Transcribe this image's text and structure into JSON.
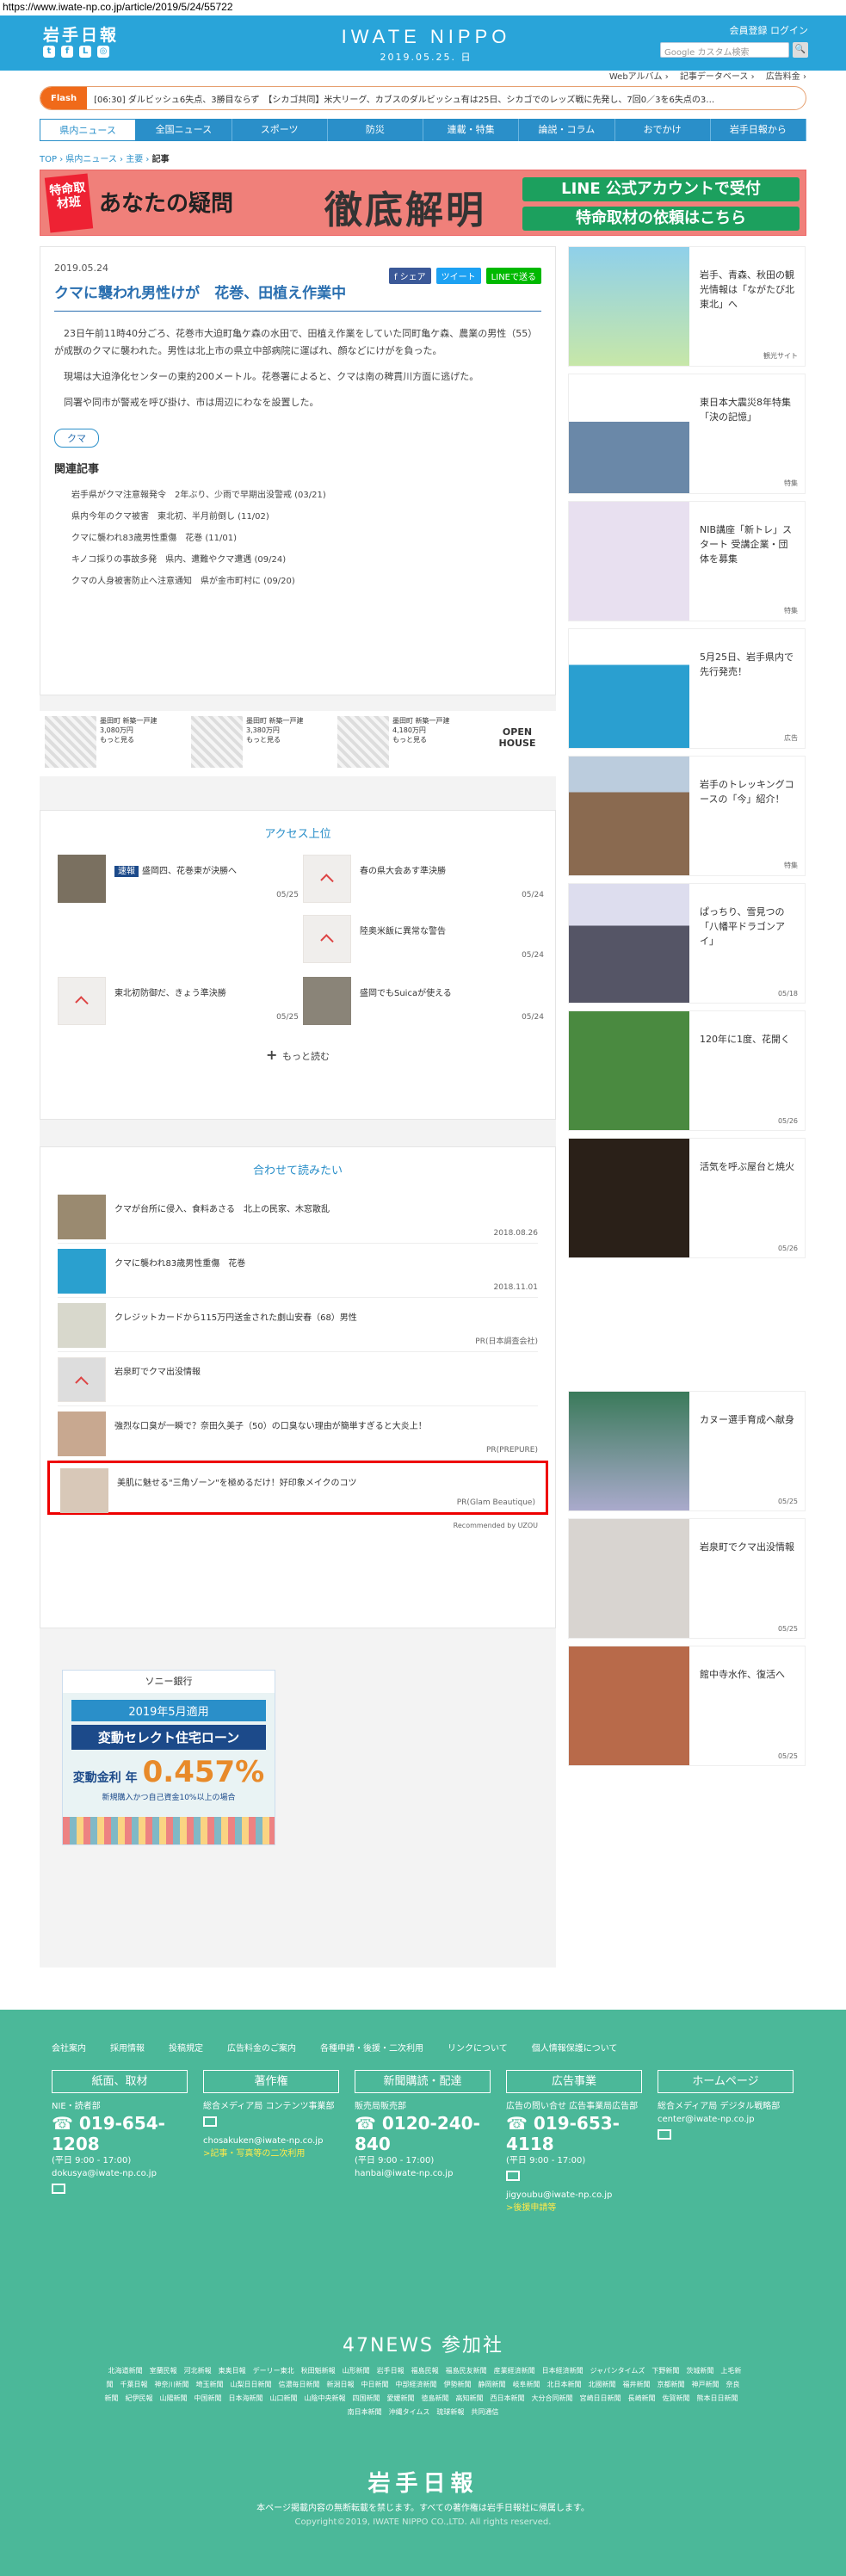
{
  "url": "https://www.iwate-np.co.jp/article/2019/5/24/55722",
  "header": {
    "logo": "岩手日報",
    "brand": "IWATE NIPPO",
    "date": "2019.05.25. 日",
    "links": "会員登録  ログイン",
    "search_placeholder": "Google カスタム検索",
    "search_btn": "🔍"
  },
  "subnav": [
    "Webアルバム ›",
    "記事データベース ›",
    "広告料金 ›"
  ],
  "flash": {
    "tag": "Flash",
    "text": "[06:30] ダルビッシュ6失点、3勝目ならず　【シカゴ共同】米大リーグ、カブスのダルビッシュ有は25日、シカゴでのレッズ戦に先発し、7回0／3を6失点の3…"
  },
  "gnav": [
    "県内ニュース",
    "全国ニュース",
    "スポーツ",
    "防災",
    "連載・特集",
    "論説・コラム",
    "おでかけ",
    "岩手日報から"
  ],
  "breadcrumb": {
    "top": "TOP",
    "sep": " › ",
    "c1": "県内ニュース",
    "c2": "主要",
    "current": "記事"
  },
  "banner": {
    "b1": "特命取材班",
    "b2": "あなたの疑問",
    "b3": "徹底解明",
    "b4": "LINE 公式アカウントで受付",
    "b5": "特命取材の依頼はこちら"
  },
  "article": {
    "date": "2019.05.24",
    "share": [
      "f シェア",
      "ツイート",
      "LINEで送る"
    ],
    "title": "クマに襲われ男性けが　花巻、田植え作業中",
    "body": [
      "23日午前11時40分ごろ、花巻市大迫町亀ケ森の水田で、田植え作業をしていた同町亀ケ森、農業の男性（55）が成獣のクマに襲われた。男性は北上市の県立中部病院に運ばれ、顔などにけがを負った。",
      "現場は大迫浄化センターの東約200メートル。花巻署によると、クマは南の稗貫川方面に逃げた。",
      "同署や同市が警戒を呼び掛け、市は周辺にわなを設置した。"
    ],
    "tag": "クマ",
    "related_title": "関連記事",
    "related": [
      "岩手県がクマ注意報発令　2年ぶり、少雨で早期出没警戒 (03/21)",
      "県内今年のクマ被害　東北初、半月前倒し (11/02)",
      "クマに襲われ83歳男性重傷　花巻 (11/01)",
      "キノコ採りの事故多発　県内、遭難やクマ遭遇 (09/24)",
      "クマの人身被害防止へ注意通知　県が金市町村に (09/20)"
    ]
  },
  "ads": [
    {
      "title": "墨田町 新築一戸建",
      "price": "3,080万円",
      "more": "もっと見る"
    },
    {
      "title": "墨田町 新築一戸建",
      "price": "3,380万円",
      "more": "もっと見る"
    },
    {
      "title": "墨田町 新築一戸建",
      "price": "4,180万円",
      "more": "もっと見る"
    }
  ],
  "ad_brand": "OPEN HOUSE",
  "access": {
    "title": "アクセス上位",
    "items": [
      {
        "label": "速報",
        "text": "盛岡四、花巻東が決勝へ",
        "date": "05/25"
      },
      {
        "text": "春の県大会あす準決勝",
        "date": "05/24"
      },
      {
        "text": "陸奥米飯に異常な警告",
        "date": "05/24"
      },
      {
        "text": "東北初防御だ、きょう準決勝",
        "date": "05/25"
      },
      {
        "text": "盛岡でもSuicaが使える",
        "date": "05/24"
      }
    ],
    "more": "もっと読む"
  },
  "reco": {
    "title": "合わせて読みたい",
    "items": [
      {
        "text": "クマが台所に侵入、食料あさる　北上の民家、木窓散乱",
        "date": "2018.08.26"
      },
      {
        "text": "クマに襲われ83歳男性重傷　花巻",
        "date": "2018.11.01"
      },
      {
        "text": "クレジットカードから115万円送金された劇山安春（68）男性",
        "date": "PR(日本調査会社)"
      },
      {
        "text": "岩泉町でクマ出没情報",
        "date": ""
      },
      {
        "text": "強烈な口臭が一瞬で？奈田久美子（50）の口臭ない理由が簡単すぎると大炎上！",
        "date": "PR(PREPURE)"
      },
      {
        "text": "美肌に魅せる\"三角ゾーン\"を極めるだけ！好印象メイクのコツ",
        "date": "PR(Glam Beautique)"
      }
    ],
    "powered": "Recommended by UZOU"
  },
  "dfp": {
    "bank": "ソニー銀行",
    "l1": "2019年5月適用",
    "l2": "変動セレクト住宅ローン",
    "label": "変動金利 年",
    "rate": "0.457%",
    "note": "新規購入かつ自己資金10%以上の場合"
  },
  "sidebar": [
    {
      "text": "岩手、青森、秋田の観光情報は「ながたび北東北」へ",
      "src": "観光サイト"
    },
    {
      "text": "東日本大震災8年特集「決の記憶」",
      "src": "特集"
    },
    {
      "text": "NIB講座「新トレ」スタート 受講企業・団体を募集",
      "src": "特集"
    },
    {
      "text": "5月25日、岩手県内で先行発売！",
      "src": "広告"
    },
    {
      "text": "岩手のトレッキングコースの「今」紹介！",
      "src": "特集"
    },
    {
      "text": "ぱっちり、雪見つの「八幡平ドラゴンアイ」",
      "src": "05/18"
    },
    {
      "text": "120年に1度、花開く",
      "src": "05/26"
    },
    {
      "text": "活気を呼ぶ屋台と焼火",
      "src": "05/26"
    },
    {
      "text": "カヌー選手育成へ献身",
      "src": "05/25"
    },
    {
      "text": "岩泉町でクマ出没情報",
      "src": "05/25"
    },
    {
      "text": "館中寺水作、復活へ",
      "src": "05/25"
    }
  ],
  "footer": {
    "links": [
      "会社案内",
      "採用情報",
      "投稿規定",
      "広告料金のご案内",
      "各種申請・後援・二次利用",
      "リンクについて",
      "個人情報保護について"
    ],
    "cols": [
      {
        "h": "紙面、取材",
        "sub": "NIE・読者部",
        "tel": "019-654-1208",
        "hours": "(平日 9:00 - 17:00)",
        "mail": "dokusya@iwate-np.co.jp",
        "extra": ""
      },
      {
        "h": "著作権",
        "sub": "総合メディア局 コンテンツ事業部",
        "tel": "",
        "hours": "",
        "mail": "chosakuken@iwate-np.co.jp",
        "extra": ">記事・写真等の二次利用"
      },
      {
        "h": "新聞購読・配達",
        "sub": "販売局販売部",
        "tel": "0120-240-840",
        "hours": "(平日 9:00 - 17:00)",
        "mail": "hanbai@iwate-np.co.jp",
        "extra": ""
      },
      {
        "h": "広告事業",
        "sub": "広告の問い合せ 広告事業局広告部",
        "tel": "019-653-4118",
        "hours": "(平日 9:00 - 17:00)",
        "mail": "jigyoubu@iwate-np.co.jp",
        "extra": ">後援申請等"
      },
      {
        "h": "ホームページ",
        "sub": "総合メディア局 デジタル戦略部",
        "tel": "",
        "hours": "",
        "mail": "center@iwate-np.co.jp",
        "extra": ""
      }
    ],
    "n47": "47NEWS 参加社",
    "papers": [
      "北海道新聞",
      "室蘭民報",
      "河北新報",
      "東奥日報",
      "デーリー東北",
      "秋田魁新報",
      "山形新聞",
      "岩手日報",
      "福島民報",
      "福島民友新聞",
      "産業経済新聞",
      "日本経済新聞",
      "ジャパンタイムズ",
      "下野新聞",
      "茨城新聞",
      "上毛新聞",
      "千葉日報",
      "神奈川新聞",
      "埼玉新聞",
      "山梨日日新聞",
      "信濃毎日新聞",
      "新潟日報",
      "中日新聞",
      "中部経済新聞",
      "伊勢新聞",
      "静岡新聞",
      "岐阜新聞",
      "北日本新聞",
      "北國新聞",
      "福井新聞",
      "京都新聞",
      "神戸新聞",
      "奈良新聞",
      "紀伊民報",
      "山陽新聞",
      "中国新聞",
      "日本海新聞",
      "山口新聞",
      "山陰中央新報",
      "四国新聞",
      "愛媛新聞",
      "徳島新聞",
      "高知新聞",
      "西日本新聞",
      "大分合同新聞",
      "宮崎日日新聞",
      "長崎新聞",
      "佐賀新聞",
      "熊本日日新聞",
      "南日本新聞",
      "沖縄タイムス",
      "琉球新報",
      "共同通信"
    ],
    "logo": "岩手日報",
    "copy1": "本ページ掲載内容の無断転載を禁じます。すべての著作権は岩手日報社に帰属します。",
    "copy2": "Copyright©2019, IWATE NIPPO CO.,LTD. All rights reserved."
  }
}
